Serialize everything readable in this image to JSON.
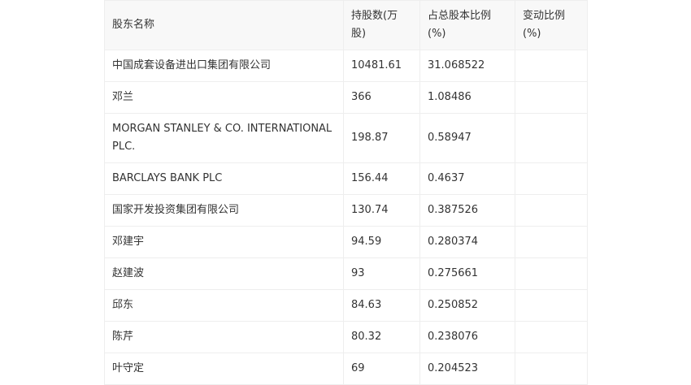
{
  "table": {
    "headers": [
      "股东名称",
      "持股数(万股)",
      "占总股本比例(%)",
      "变动比例(%)"
    ],
    "rows": [
      [
        "中国成套设备进出口集团有限公司",
        "10481.61",
        "31.068522",
        ""
      ],
      [
        "邓兰",
        "366",
        "1.08486",
        ""
      ],
      [
        "MORGAN STANLEY & CO. INTERNATIONAL PLC.",
        "198.87",
        "0.58947",
        ""
      ],
      [
        "BARCLAYS BANK PLC",
        "156.44",
        "0.4637",
        ""
      ],
      [
        "国家开发投资集团有限公司",
        "130.74",
        "0.387526",
        ""
      ],
      [
        "邓建宇",
        "94.59",
        "0.280374",
        ""
      ],
      [
        "赵建波",
        "93",
        "0.275661",
        ""
      ],
      [
        "邱东",
        "84.63",
        "0.250852",
        ""
      ],
      [
        "陈芹",
        "80.32",
        "0.238076",
        ""
      ],
      [
        "叶守定",
        "69",
        "0.204523",
        ""
      ]
    ]
  }
}
